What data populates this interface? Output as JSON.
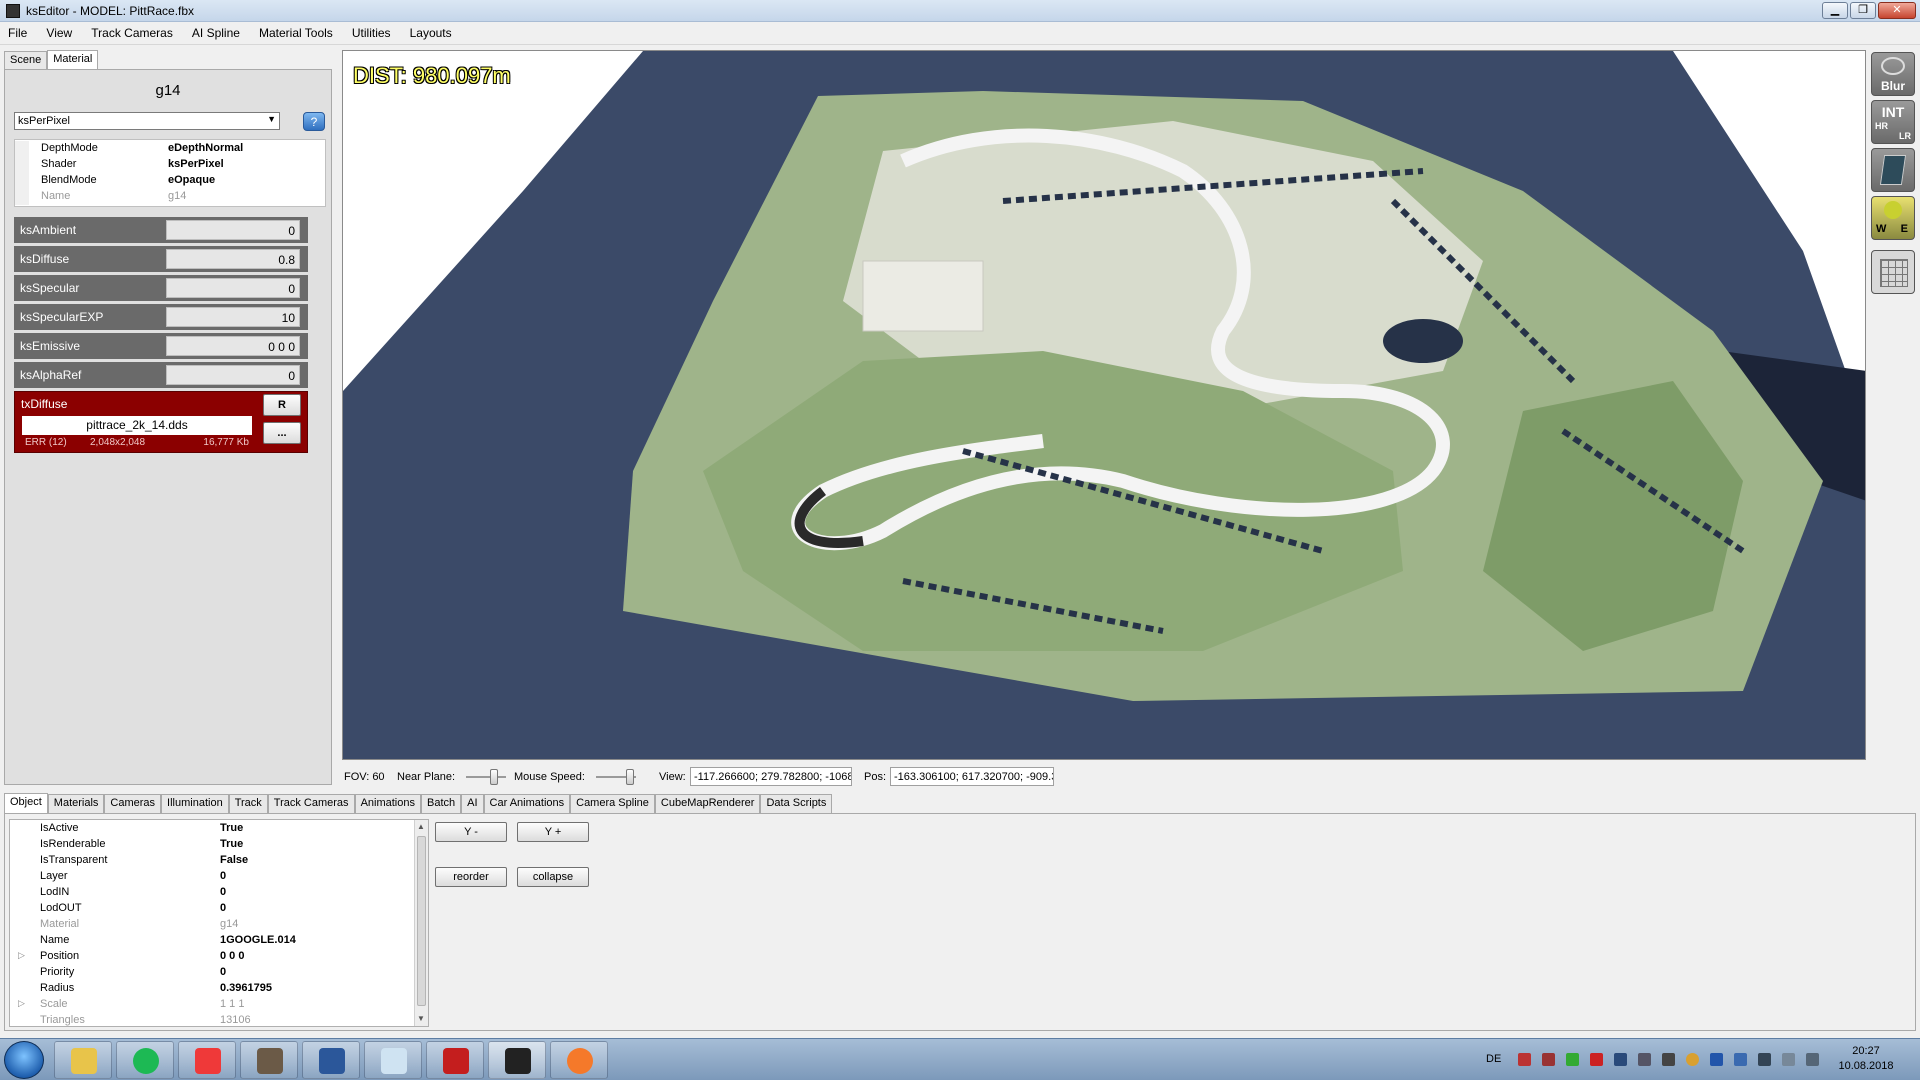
{
  "window": {
    "title": "ksEditor - MODEL: PittRace.fbx",
    "minimize": "▁",
    "restore": "❐",
    "close": "✕"
  },
  "menu": [
    "File",
    "View",
    "Track Cameras",
    "AI Spline",
    "Material Tools",
    "Utilities",
    "Layouts"
  ],
  "left_tabs": [
    "Scene",
    "Material"
  ],
  "material": {
    "name": "g14",
    "shader_select": "ksPerPixel",
    "help": "?",
    "props": [
      {
        "k": "DepthMode",
        "v": "eDepthNormal",
        "dim": false
      },
      {
        "k": "Shader",
        "v": "ksPerPixel",
        "dim": false
      },
      {
        "k": "BlendMode",
        "v": "eOpaque",
        "dim": false
      },
      {
        "k": "Name",
        "v": "g14",
        "dim": true
      }
    ],
    "params": [
      {
        "label": "ksAmbient",
        "value": "0"
      },
      {
        "label": "ksDiffuse",
        "value": "0.8"
      },
      {
        "label": "ksSpecular",
        "value": "0"
      },
      {
        "label": "ksSpecularEXP",
        "value": "10"
      },
      {
        "label": "ksEmissive",
        "value": "0 0 0"
      },
      {
        "label": "ksAlphaRef",
        "value": "0"
      }
    ],
    "texture": {
      "label": "txDiffuse",
      "file": "pittrace_2k_14.dds",
      "err": "ERR (12)",
      "size": "2,048x2,048",
      "kb": "16,777 Kb",
      "reload": "R",
      "browse": "..."
    }
  },
  "viewport": {
    "dist": "DIST: 980.097m"
  },
  "tools": [
    "Blur",
    "INT",
    "HR",
    "LR",
    "W",
    "E"
  ],
  "status": {
    "fov": "FOV: 60",
    "near_plane": "Near Plane:",
    "mouse_speed": "Mouse Speed:",
    "view_label": "View:",
    "view_value": "-117.266600; 279.782800; -1068.",
    "pos_label": "Pos:",
    "pos_value": "-163.306100; 617.320700; -909.3"
  },
  "bottom_tabs": [
    "Object",
    "Materials",
    "Cameras",
    "Illumination",
    "Track",
    "Track Cameras",
    "Animations",
    "Batch",
    "AI",
    "Car Animations",
    "Camera Spline",
    "CubeMapRenderer",
    "Data Scripts"
  ],
  "object": [
    {
      "k": "IsActive",
      "v": "True",
      "dim": false,
      "exp": ""
    },
    {
      "k": "IsRenderable",
      "v": "True",
      "dim": false,
      "exp": ""
    },
    {
      "k": "IsTransparent",
      "v": "False",
      "dim": false,
      "exp": ""
    },
    {
      "k": "Layer",
      "v": "0",
      "dim": false,
      "exp": ""
    },
    {
      "k": "LodIN",
      "v": "0",
      "dim": false,
      "exp": ""
    },
    {
      "k": "LodOUT",
      "v": "0",
      "dim": false,
      "exp": ""
    },
    {
      "k": "Material",
      "v": "g14",
      "dim": true,
      "exp": ""
    },
    {
      "k": "Name",
      "v": "1GOOGLE.014",
      "dim": false,
      "exp": ""
    },
    {
      "k": "Position",
      "v": "0 0 0",
      "dim": false,
      "exp": "▷"
    },
    {
      "k": "Priority",
      "v": "0",
      "dim": false,
      "exp": ""
    },
    {
      "k": "Radius",
      "v": "0.3961795",
      "dim": false,
      "exp": ""
    },
    {
      "k": "Scale",
      "v": "1 1 1",
      "dim": true,
      "exp": "▷"
    },
    {
      "k": "Triangles",
      "v": "13106",
      "dim": true,
      "exp": ""
    }
  ],
  "object_buttons": {
    "y_minus": "Y -",
    "y_plus": "Y +",
    "reorder": "reorder",
    "collapse": "collapse"
  },
  "taskbar": {
    "lang": "DE",
    "time": "20:27",
    "date": "10.08.2018",
    "apps": [
      "explorer",
      "spotify",
      "vivaldi",
      "gimp",
      "word",
      "notepad",
      "assetto-corsa",
      "kseditor",
      "blender"
    ]
  }
}
